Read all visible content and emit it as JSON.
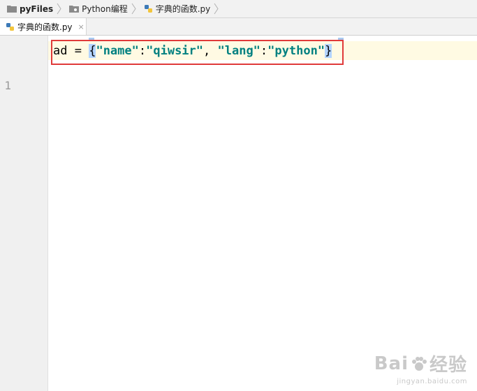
{
  "breadcrumb": {
    "items": [
      {
        "label": "pyFiles",
        "icon": "folder-icon"
      },
      {
        "label": "Python编程",
        "icon": "folder-icon"
      },
      {
        "label": "字典的函数.py",
        "icon": "python-file-icon"
      }
    ]
  },
  "tabs": [
    {
      "label": "字典的函数.py",
      "icon": "python-file-icon",
      "close": "×"
    }
  ],
  "editor": {
    "line_number": "1",
    "code": {
      "var": "ad",
      "op": " = ",
      "open": "{",
      "k1": "\"name\"",
      "colon1": ":",
      "v1": "\"qiwsir\"",
      "comma": ", ",
      "k2": "\"lang\"",
      "colon2": ":",
      "v2": "\"python\"",
      "close": "}"
    }
  },
  "watermark": {
    "main_left": "Bai",
    "main_right": "经验",
    "sub": "jingyan.baidu.com"
  },
  "colors": {
    "string": "#008080",
    "highlight_box": "#e03a3a",
    "current_line": "#fffae3"
  }
}
